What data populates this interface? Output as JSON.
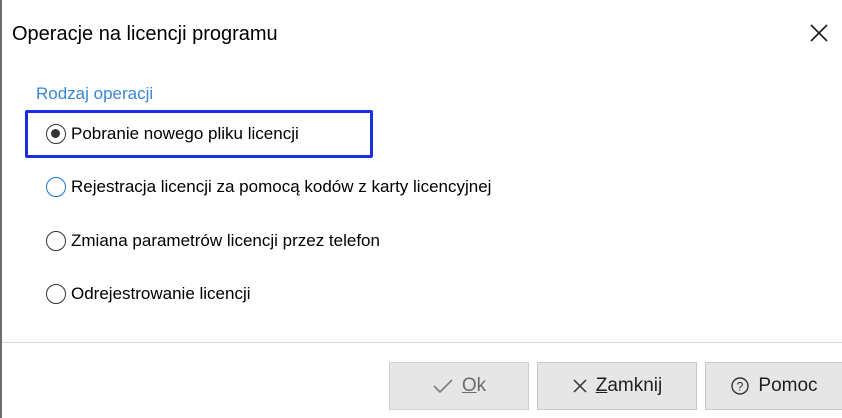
{
  "window": {
    "title": "Operacje na licencji programu"
  },
  "group": {
    "label": "Rodzaj operacji",
    "options": [
      {
        "label": "Pobranie nowego pliku licencji",
        "selected": true
      },
      {
        "label": "Rejestracja licencji za pomocą kodów z karty licencyjnej",
        "selected": false
      },
      {
        "label": "Zmiana parametrów licencji przez telefon",
        "selected": false
      },
      {
        "label": "Odrejestrowanie licencji",
        "selected": false
      }
    ]
  },
  "buttons": {
    "ok": {
      "mnemonic": "O",
      "rest": "k",
      "icon": "checkmark-icon"
    },
    "close": {
      "mnemonic": "Z",
      "rest": "amknij",
      "icon": "close-x-icon"
    },
    "help": {
      "label": "Pomoc",
      "icon": "help-circle-icon"
    }
  },
  "colors": {
    "group_label": "#3a86d1",
    "focus_border": "#1b2fe0",
    "hover_radio_border": "#1a73d9",
    "button_bg": "#e6e6e6"
  }
}
